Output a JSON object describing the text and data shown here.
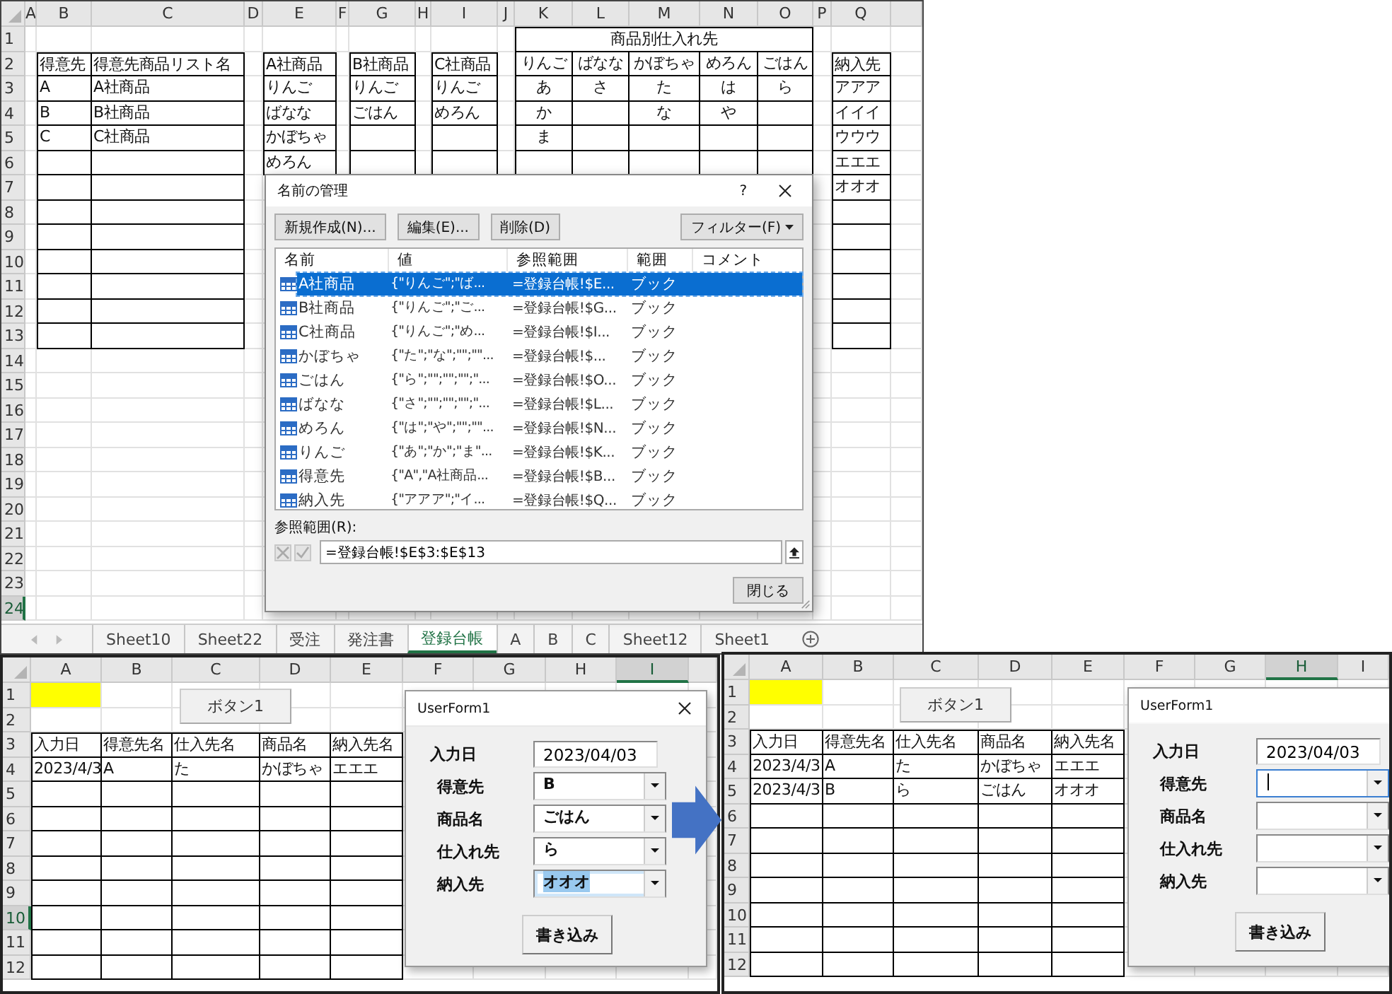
{
  "top_sheet": {
    "columns": [
      {
        "label": "A",
        "selected": false
      },
      {
        "label": "B",
        "selected": false
      },
      {
        "label": "C",
        "selected": false
      },
      {
        "label": "D",
        "selected": false
      },
      {
        "label": "E",
        "selected": false
      },
      {
        "label": "F",
        "selected": false
      },
      {
        "label": "G",
        "selected": false
      },
      {
        "label": "H",
        "selected": false
      },
      {
        "label": "I",
        "selected": false
      },
      {
        "label": "J",
        "selected": false
      },
      {
        "label": "K",
        "selected": false
      },
      {
        "label": "L",
        "selected": false
      },
      {
        "label": "M",
        "selected": false
      },
      {
        "label": "N",
        "selected": false
      },
      {
        "label": "O",
        "selected": false
      },
      {
        "label": "P",
        "selected": false
      },
      {
        "label": "Q",
        "selected": false
      }
    ],
    "rows": [
      {
        "number": "1",
        "selected": false,
        "cells": [
          null,
          null,
          null,
          null,
          null,
          null,
          null,
          null,
          null,
          null,
          "商品別仕入れ先"
        ]
      },
      {
        "number": "2",
        "selected": false,
        "cells": [
          null,
          "得意先",
          "得意先商品リスト名",
          null,
          "A社商品",
          null,
          "B社商品",
          null,
          "C社商品",
          null,
          "りんご",
          "ばなな",
          "かぼちゃ",
          "めろん",
          "ごはん",
          null,
          "納入先"
        ]
      },
      {
        "number": "3",
        "selected": false,
        "cells": [
          null,
          "A",
          "A社商品",
          null,
          "りんご",
          null,
          "りんご",
          null,
          "りんご",
          null,
          "あ",
          "さ",
          "た",
          "は",
          "ら",
          null,
          "アアア"
        ]
      },
      {
        "number": "4",
        "selected": false,
        "cells": [
          null,
          "B",
          "B社商品",
          null,
          "ばなな",
          null,
          "ごはん",
          null,
          "めろん",
          null,
          "か",
          null,
          "な",
          "や",
          null,
          null,
          "イイイ"
        ]
      },
      {
        "number": "5",
        "selected": false,
        "cells": [
          null,
          "C",
          "C社商品",
          null,
          "かぼちゃ",
          null,
          null,
          null,
          null,
          null,
          "ま",
          null,
          null,
          null,
          null,
          null,
          "ウウウ"
        ]
      },
      {
        "number": "6",
        "selected": false,
        "cells": [
          null,
          null,
          null,
          null,
          "めろん",
          null,
          null,
          null,
          null,
          null,
          null,
          null,
          null,
          null,
          null,
          null,
          "エエエ"
        ]
      },
      {
        "number": "7",
        "selected": false,
        "cells": [
          null,
          null,
          null,
          null,
          null,
          null,
          null,
          null,
          null,
          null,
          null,
          null,
          null,
          null,
          null,
          null,
          "オオオ"
        ]
      },
      {
        "number": "8",
        "selected": false
      },
      {
        "number": "9",
        "selected": false
      },
      {
        "number": "10",
        "selected": false
      },
      {
        "number": "11",
        "selected": false
      },
      {
        "number": "12",
        "selected": false
      },
      {
        "number": "13",
        "selected": false
      },
      {
        "number": "14",
        "selected": false
      },
      {
        "number": "15",
        "selected": false
      },
      {
        "number": "16",
        "selected": false
      },
      {
        "number": "17",
        "selected": false
      },
      {
        "number": "18",
        "selected": false
      },
      {
        "number": "19",
        "selected": false
      },
      {
        "number": "20",
        "selected": false
      },
      {
        "number": "21",
        "selected": false
      },
      {
        "number": "22",
        "selected": false
      },
      {
        "number": "23",
        "selected": false
      },
      {
        "number": "24",
        "selected": true
      }
    ],
    "sheet_tabs": [
      {
        "label": "Sheet10",
        "selected": false
      },
      {
        "label": "Sheet22",
        "selected": false
      },
      {
        "label": "受注",
        "selected": false
      },
      {
        "label": "発注書",
        "selected": false
      },
      {
        "label": "登録台帳",
        "selected": true
      },
      {
        "label": "A",
        "selected": false
      },
      {
        "label": "B",
        "selected": false
      },
      {
        "label": "C",
        "selected": false
      },
      {
        "label": "Sheet12",
        "selected": false
      },
      {
        "label": "Sheet1",
        "selected": false
      }
    ]
  },
  "name_manager": {
    "title": "名前の管理",
    "help": "?",
    "buttons": [
      "新規作成(N)...",
      "編集(E)...",
      "削除(D)"
    ],
    "filter_button": "フィルター(F)",
    "list_columns": [
      "名前",
      "値",
      "参照範囲",
      "範囲",
      "コメント"
    ],
    "names": [
      {
        "name": "A社商品",
        "value": "{\"りんご\";\"ば...",
        "refers_to": "=登録台帳!$E...",
        "scope": "ブック",
        "selected": true
      },
      {
        "name": "B社商品",
        "value": "{\"りんご\";\"ご...",
        "refers_to": "=登録台帳!$G...",
        "scope": "ブック",
        "selected": false
      },
      {
        "name": "C社商品",
        "value": "{\"りんご\";\"め...",
        "refers_to": "=登録台帳!$I...",
        "scope": "ブック",
        "selected": false
      },
      {
        "name": "かぼちゃ",
        "value": "{\"た\";\"な\";\"\";\"\"...",
        "refers_to": "=登録台帳!$...",
        "scope": "ブック",
        "selected": false
      },
      {
        "name": "ごはん",
        "value": "{\"ら\";\"\";\"\";\"\";\"...",
        "refers_to": "=登録台帳!$O...",
        "scope": "ブック",
        "selected": false
      },
      {
        "name": "ばなな",
        "value": "{\"さ\";\"\";\"\";\"\";\"...",
        "refers_to": "=登録台帳!$L...",
        "scope": "ブック",
        "selected": false
      },
      {
        "name": "めろん",
        "value": "{\"は\";\"や\";\"\";\"\"...",
        "refers_to": "=登録台帳!$N...",
        "scope": "ブック",
        "selected": false
      },
      {
        "name": "りんご",
        "value": "{\"あ\";\"か\";\"ま\"...",
        "refers_to": "=登録台帳!$K...",
        "scope": "ブック",
        "selected": false
      },
      {
        "name": "得意先",
        "value": "{\"A\",\"A社商品...",
        "refers_to": "=登録台帳!$B...",
        "scope": "ブック",
        "selected": false
      },
      {
        "name": "納入先",
        "value": "{\"アアア\";\"イ...",
        "refers_to": "=登録台帳!$Q...",
        "scope": "ブック",
        "selected": false
      }
    ],
    "refers_label": "参照範囲(R):",
    "refers_value": "=登録台帳!$E$3:$E$13",
    "close_button": "閉じる"
  },
  "before_sheet": {
    "columns": [
      {
        "label": "A",
        "selected": false
      },
      {
        "label": "B",
        "selected": false
      },
      {
        "label": "C",
        "selected": false
      },
      {
        "label": "D",
        "selected": false
      },
      {
        "label": "E",
        "selected": false
      },
      {
        "label": "F",
        "selected": false
      },
      {
        "label": "G",
        "selected": false
      },
      {
        "label": "H",
        "selected": false
      },
      {
        "label": "I",
        "selected": true
      }
    ],
    "rows": [
      {
        "number": "1",
        "selected": false,
        "cells": [
          {
            "color": "#ffff00"
          }
        ]
      },
      {
        "number": "2",
        "selected": false
      },
      {
        "number": "3",
        "selected": false,
        "cells": [
          "入力日",
          "得意先名",
          "仕入先名",
          "商品名",
          "納入先名"
        ]
      },
      {
        "number": "4",
        "selected": false,
        "cells": [
          "2023/4/3",
          "A",
          "た",
          "かぼちゃ",
          "エエエ"
        ]
      },
      {
        "number": "5",
        "selected": false
      },
      {
        "number": "6",
        "selected": false
      },
      {
        "number": "7",
        "selected": false
      },
      {
        "number": "8",
        "selected": false
      },
      {
        "number": "9",
        "selected": false
      },
      {
        "number": "10",
        "selected": true
      },
      {
        "number": "11",
        "selected": false
      },
      {
        "number": "12",
        "selected": false
      }
    ],
    "sheet_button": "ボタン1",
    "form": {
      "title": "UserForm1",
      "closable": true,
      "submit": "書き込み",
      "fields": [
        {
          "label": "入力日",
          "kind": "text",
          "value": "2023/04/03",
          "focused": false,
          "text_selected": false
        },
        {
          "label": "得意先",
          "kind": "combo",
          "value": "B",
          "focused": false,
          "text_selected": false
        },
        {
          "label": "商品名",
          "kind": "combo",
          "value": "ごはん",
          "focused": false,
          "text_selected": false
        },
        {
          "label": "仕入れ先",
          "kind": "combo",
          "value": "ら",
          "focused": false,
          "text_selected": false
        },
        {
          "label": "納入先",
          "kind": "combo",
          "value": "オオオ",
          "focused": false,
          "text_selected": true
        }
      ]
    }
  },
  "after_sheet": {
    "columns": [
      {
        "label": "A",
        "selected": false
      },
      {
        "label": "B",
        "selected": false
      },
      {
        "label": "C",
        "selected": false
      },
      {
        "label": "D",
        "selected": false
      },
      {
        "label": "E",
        "selected": false
      },
      {
        "label": "F",
        "selected": false
      },
      {
        "label": "G",
        "selected": false
      },
      {
        "label": "H",
        "selected": true
      },
      {
        "label": "I",
        "selected": false
      }
    ],
    "rows": [
      {
        "number": "1",
        "selected": false,
        "cells": [
          {
            "color": "#ffff00"
          }
        ]
      },
      {
        "number": "2",
        "selected": false
      },
      {
        "number": "3",
        "selected": false,
        "cells": [
          "入力日",
          "得意先名",
          "仕入先名",
          "商品名",
          "納入先名"
        ]
      },
      {
        "number": "4",
        "selected": false,
        "cells": [
          "2023/4/3",
          "A",
          "た",
          "かぼちゃ",
          "エエエ"
        ]
      },
      {
        "number": "5",
        "selected": false,
        "cells": [
          "2023/4/3",
          "B",
          "ら",
          "ごはん",
          "オオオ"
        ]
      },
      {
        "number": "6",
        "selected": false
      },
      {
        "number": "7",
        "selected": false
      },
      {
        "number": "8",
        "selected": false
      },
      {
        "number": "9",
        "selected": false
      },
      {
        "number": "10",
        "selected": false
      },
      {
        "number": "11",
        "selected": false
      },
      {
        "number": "12",
        "selected": false
      }
    ],
    "sheet_button": "ボタン1",
    "form": {
      "title": "UserForm1",
      "closable": false,
      "submit": "書き込み",
      "fields": [
        {
          "label": "入力日",
          "kind": "text",
          "value": "2023/04/03",
          "focused": false,
          "text_selected": false
        },
        {
          "label": "得意先",
          "kind": "combo",
          "focused": true,
          "text_selected": false
        },
        {
          "label": "商品名",
          "kind": "combo",
          "focused": false,
          "text_selected": false
        },
        {
          "label": "仕入れ先",
          "kind": "combo",
          "focused": false,
          "text_selected": false
        },
        {
          "label": "納入先",
          "kind": "combo",
          "focused": false,
          "text_selected": false
        }
      ]
    }
  }
}
